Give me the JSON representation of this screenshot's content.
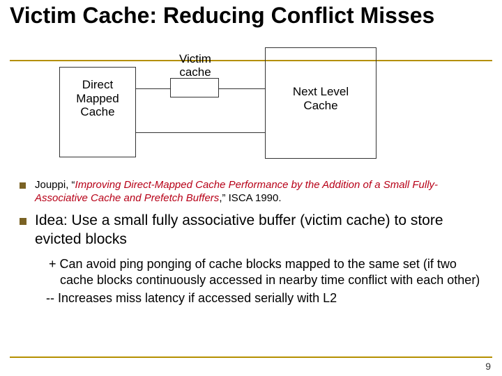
{
  "title": "Victim Cache: Reducing Conflict Misses",
  "diagram": {
    "dmc": "Direct\nMapped\nCache",
    "vc": "Victim\ncache",
    "nlc": "Next Level\nCache"
  },
  "bullets": [
    {
      "prefix": "Jouppi, “",
      "highlight": "Improving Direct-Mapped Cache Performance by the Addition of a Small Fully-Associative Cache and Prefetch Buffers",
      "suffix": ",” ISCA 1990."
    },
    {
      "prefix": "Idea: ",
      "rest": "Use a small fully associative buffer (victim cache) to store evicted blocks"
    }
  ],
  "sub": {
    "plus": "+ Can avoid ping ponging of cache blocks mapped to the same set (if two cache blocks continuously accessed in nearby time conflict with each other)",
    "minus": "-- Increases miss latency if accessed serially with L2"
  },
  "page": "9"
}
